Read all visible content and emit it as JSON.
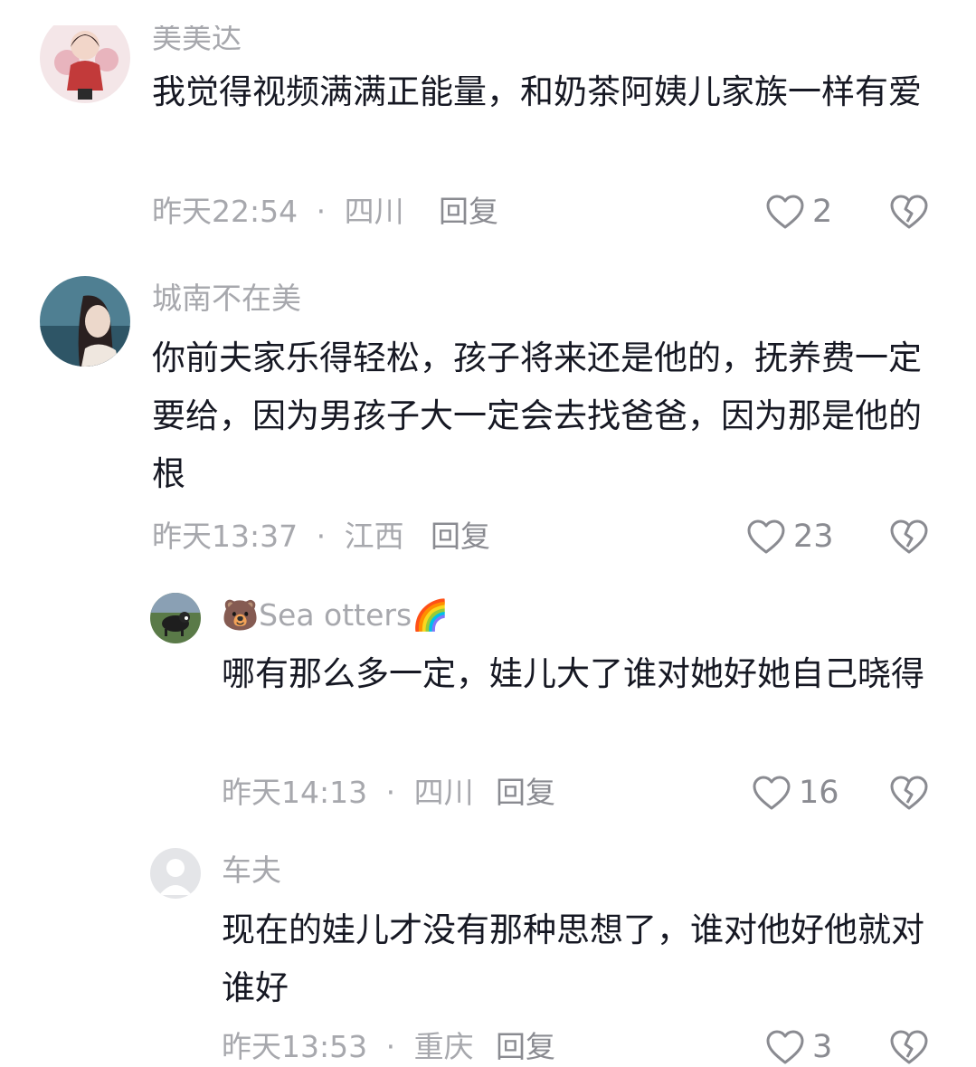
{
  "comments": [
    {
      "username": "美美达",
      "text": "我觉得视频满满正能量，和奶茶阿姨儿家族一样有爱",
      "time": "昨天22:54",
      "separator": "·",
      "location": "四川",
      "reply_label": "回复",
      "likes": "2"
    },
    {
      "username": "城南不在美",
      "text": "你前夫家乐得轻松，孩子将来还是他的，抚养费一定要给，因为男孩子大一定会去找爸爸，因为那是他的根",
      "time": "昨天13:37",
      "separator": "·",
      "location": "江西",
      "reply_label": "回复",
      "likes": "23"
    },
    {
      "username": "🐻Sea  otters🌈",
      "text": "哪有那么多一定，娃儿大了谁对她好她自己晓得",
      "time": "昨天14:13",
      "separator": "·",
      "location": "四川",
      "reply_label": "回复",
      "likes": "16"
    },
    {
      "username": "车夫",
      "text": "现在的娃儿才没有那种思想了，谁对他好他就对谁好",
      "time": "昨天13:53",
      "separator": "·",
      "location": "重庆",
      "reply_label": "回复",
      "likes": "3"
    }
  ],
  "colors": {
    "primary_text": "#161823",
    "secondary_text": "#a7a8ad",
    "icon_stroke": "#8a8b91"
  },
  "icons": {
    "like": "heart-outline-icon",
    "dislike": "broken-heart-icon"
  }
}
